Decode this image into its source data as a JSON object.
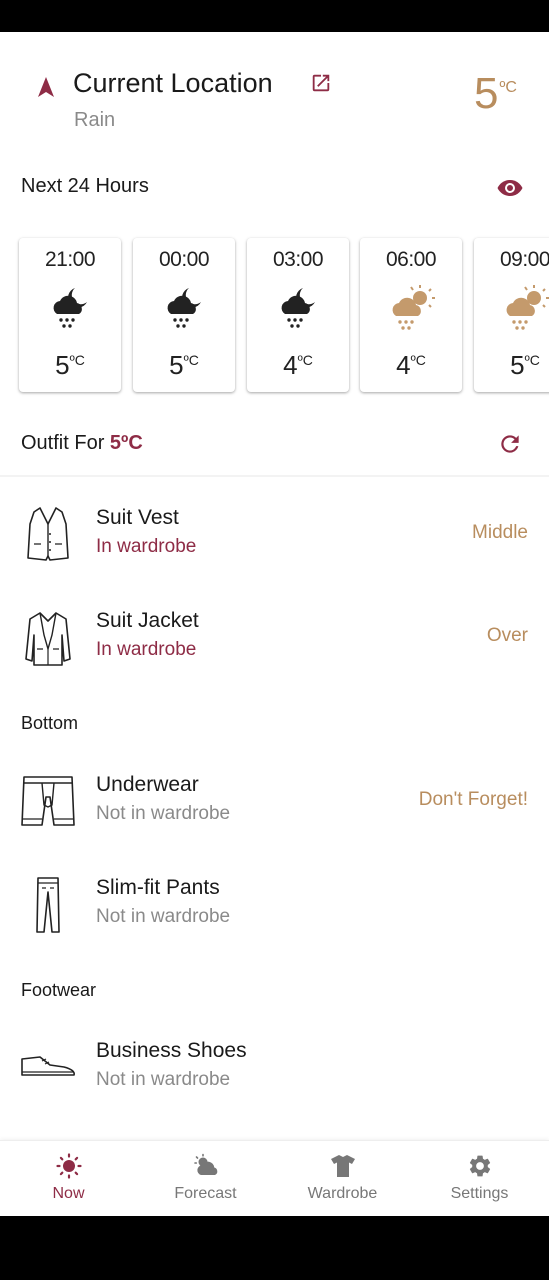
{
  "header": {
    "title": "Current Location",
    "condition": "Rain",
    "temp": "5",
    "temp_unit": "ºC"
  },
  "next24": {
    "title": "Next 24 Hours"
  },
  "hours": [
    {
      "time": "21:00",
      "temp": "5",
      "unit": "ºC",
      "icon": "night-rain-icon"
    },
    {
      "time": "00:00",
      "temp": "5",
      "unit": "ºC",
      "icon": "night-rain-icon"
    },
    {
      "time": "03:00",
      "temp": "4",
      "unit": "ºC",
      "icon": "night-rain-icon"
    },
    {
      "time": "06:00",
      "temp": "4",
      "unit": "ºC",
      "icon": "day-rain-icon"
    },
    {
      "time": "09:00",
      "temp": "5",
      "unit": "ºC",
      "icon": "day-rain-icon"
    }
  ],
  "outfit": {
    "title_prefix": "Outfit For",
    "temp": "5ºC"
  },
  "items_top": [
    {
      "name": "Suit Vest",
      "status": "In wardrobe",
      "layer": "Middle",
      "icon": "vest-icon"
    },
    {
      "name": "Suit Jacket",
      "status": "In wardrobe",
      "layer": "Over",
      "icon": "jacket-icon"
    }
  ],
  "bottom": {
    "title": "Bottom",
    "items": [
      {
        "name": "Underwear",
        "status": "Not in wardrobe",
        "layer": "Don't Forget!",
        "icon": "underwear-icon"
      },
      {
        "name": "Slim-fit Pants",
        "status": "Not in wardrobe",
        "icon": "pants-icon"
      }
    ]
  },
  "footwear": {
    "title": "Footwear",
    "items": [
      {
        "name": "Business Shoes",
        "status": "Not in wardrobe",
        "icon": "shoe-icon"
      }
    ]
  },
  "nav": [
    {
      "label": "Now",
      "icon": "sun-icon",
      "active": true
    },
    {
      "label": "Forecast",
      "icon": "cloud-sun-icon",
      "active": false
    },
    {
      "label": "Wardrobe",
      "icon": "tshirt-icon",
      "active": false
    },
    {
      "label": "Settings",
      "icon": "gear-icon",
      "active": false
    }
  ],
  "colors": {
    "accent": "#8e2c46",
    "gold": "#b88d5e",
    "muted": "#8a8a8a"
  }
}
